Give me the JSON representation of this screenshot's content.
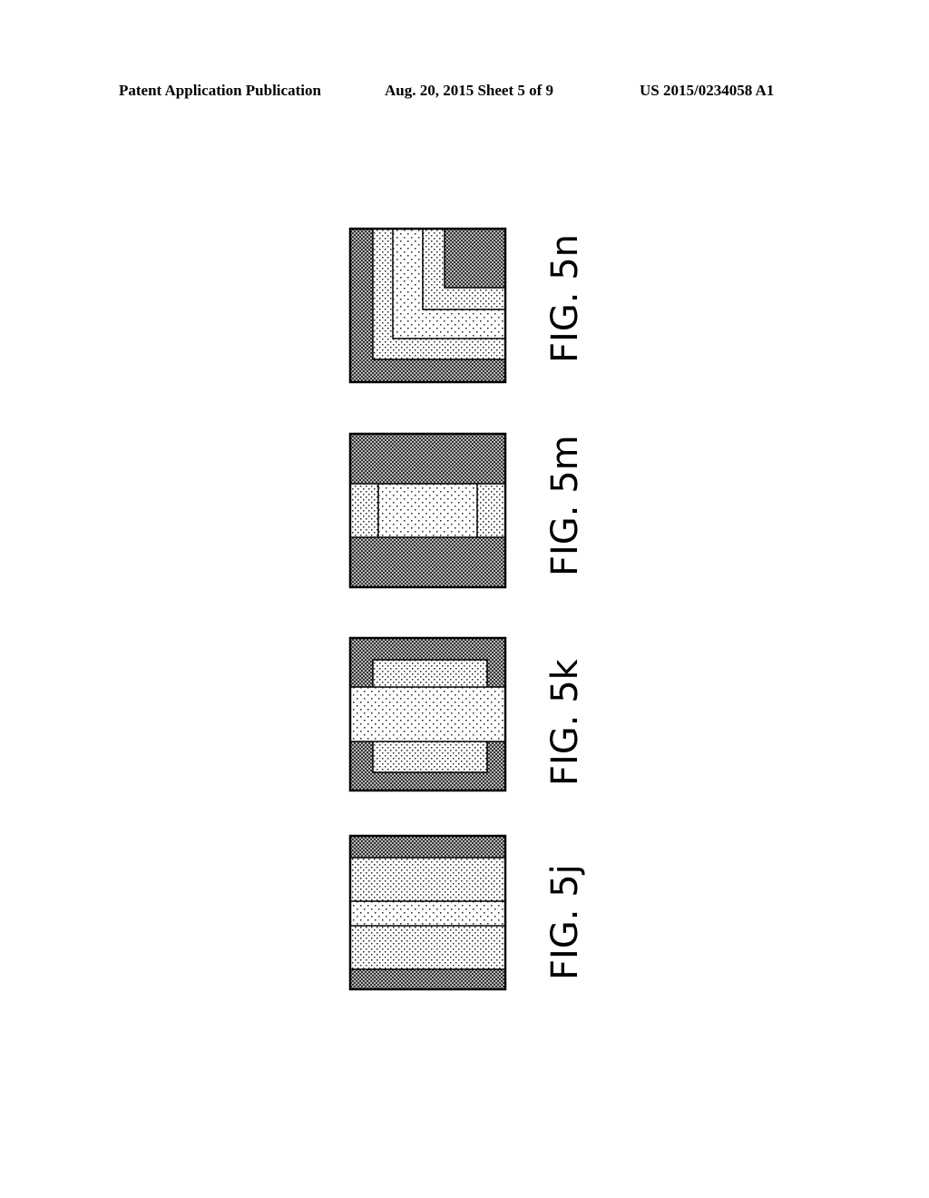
{
  "header": {
    "publication": "Patent Application Publication",
    "date_sheet": "Aug. 20, 2015  Sheet 5 of 9",
    "number": "US 2015/0234058 A1"
  },
  "figures": [
    {
      "id": "5n",
      "caption": "FIG. 5n",
      "description": "nested L-shaped layers: dense outer, light, lighter, light, dense corner region"
    },
    {
      "id": "5m",
      "caption": "FIG. 5m",
      "description": "dense top and bottom bands; middle band with light sides and lighter center"
    },
    {
      "id": "5k",
      "caption": "FIG. 5k",
      "description": "dense frame with light inset rectangles top and bottom; lighter full-width middle band"
    },
    {
      "id": "5j",
      "caption": "FIG. 5j",
      "description": "horizontal stripes: dense, light, lighter, light, dense"
    }
  ],
  "colors": {
    "dense_fill": "#8a8a8a",
    "light_fill": "#d8d8d8",
    "lighter_fill": "#ececec",
    "stroke": "#000000"
  }
}
